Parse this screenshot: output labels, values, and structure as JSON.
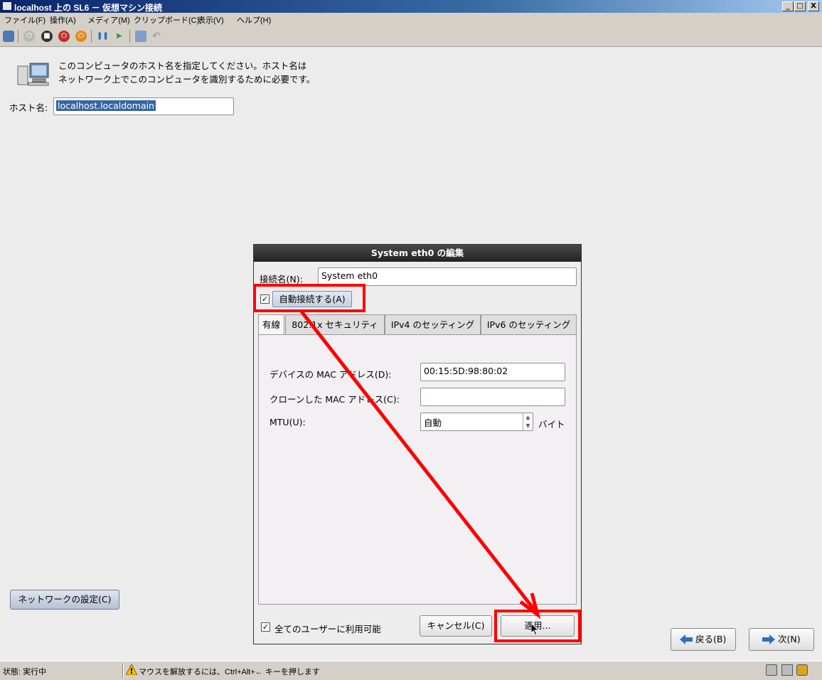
{
  "window": {
    "title": "localhost 上の SL6 － 仮想マシン接続",
    "controls": [
      "_",
      "□",
      "X"
    ]
  },
  "menu": [
    "ファイル(F)",
    "操作(A)",
    "メディア(M)",
    "クリップボード(C)",
    "表示(V)",
    "ヘルプ(H)"
  ],
  "toolbar": {
    "icons": [
      "ctrl-alt-del-icon",
      "start-icon",
      "turnoff-icon",
      "shutdown-icon",
      "save-icon",
      "pause-icon",
      "reset-icon",
      "snapshot-icon",
      "revert-icon"
    ]
  },
  "installer": {
    "description_line1": "このコンピュータのホスト名を指定してください。ホスト名は",
    "description_line2": "ネットワーク上でこのコンピュータを識別するために必要です。",
    "hostname_label": "ホスト名:",
    "hostname_value": "localhost.localdomain",
    "network_button": "ネットワークの設定(C)",
    "back_button": "戻る(B)",
    "next_button": "次(N)"
  },
  "dialog": {
    "title": "System eth0 の編集",
    "conn_name_label": "接続名(N):",
    "conn_name_value": "System eth0",
    "autoconnect_checked": true,
    "autoconnect_label": "自動接続する(A)",
    "tabs": [
      "有線",
      "802.1x セキュリティ",
      "IPv4 のセッティング",
      "IPv6 のセッティング"
    ],
    "active_tab": "有線",
    "mac_label": "デバイスの MAC アドレス(D):",
    "mac_value": "00:15:5D:98:80:02",
    "clone_mac_label": "クローンした MAC アドレス(C):",
    "clone_mac_value": "",
    "mtu_label": "MTU(U):",
    "mtu_value": "自動",
    "mtu_unit": "バイト",
    "all_users_checked": true,
    "all_users_label": "全てのユーザーに利用可能",
    "cancel_button": "キャンセル(C)",
    "apply_button": "適用..."
  },
  "statusbar": {
    "state": "状態: 実行中",
    "message": "マウスを解放するには、Ctrl+Alt+← キーを押します"
  },
  "colors": {
    "annotation": "#ff0000",
    "selection": "#3465a4",
    "dialog_title": "#2b2b2b"
  }
}
